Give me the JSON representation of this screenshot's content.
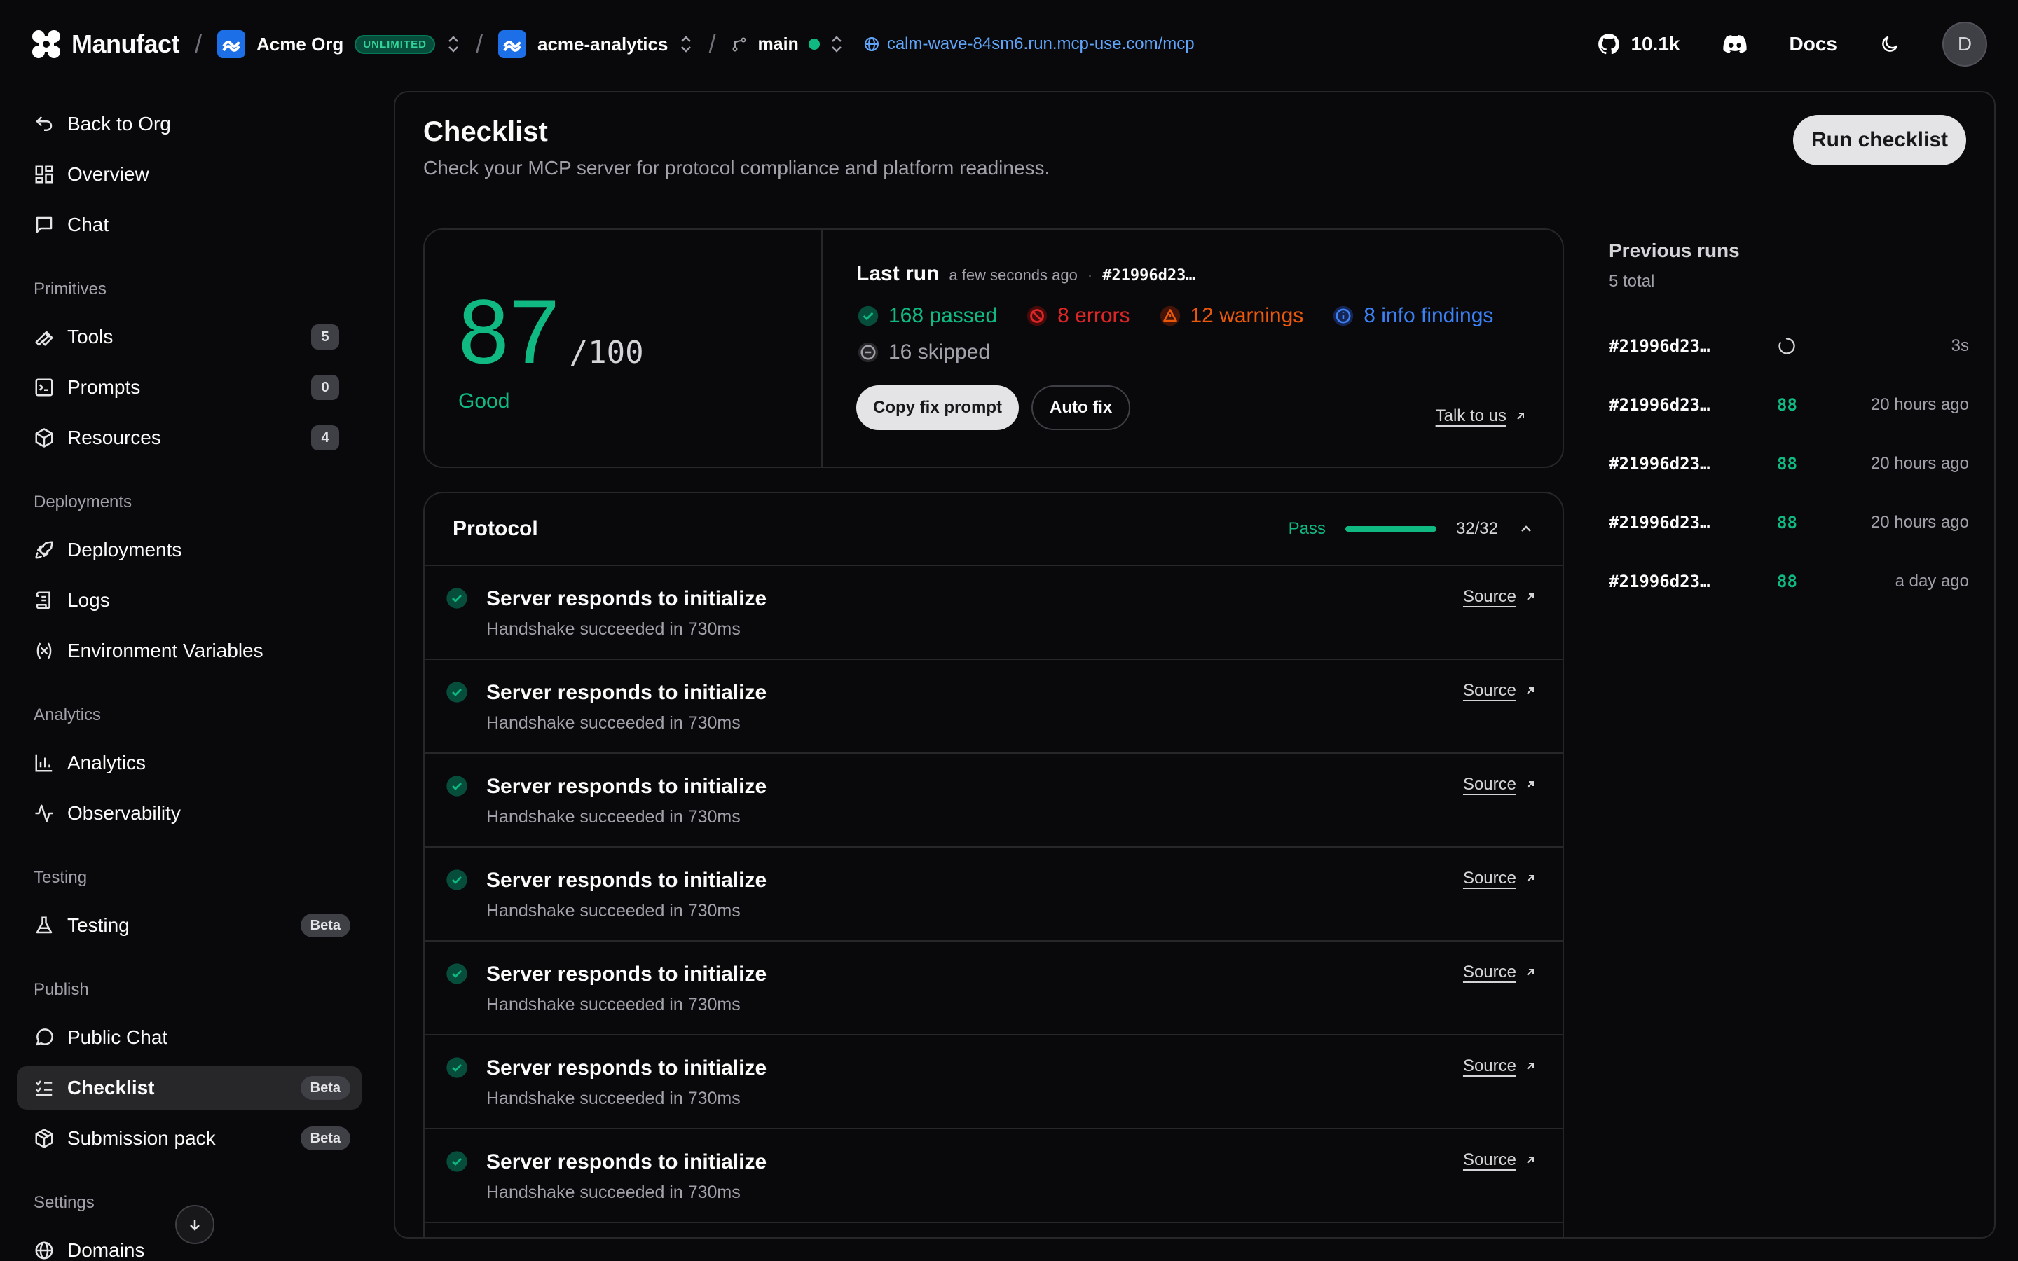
{
  "topbar": {
    "brand": "Manufact",
    "org_name": "Acme Org",
    "org_badge": "UNLIMITED",
    "project": "acme-analytics",
    "branch": "main",
    "url": "calm-wave-84sm6.run.mcp-use.com/mcp",
    "github_stars": "10.1k",
    "docs": "Docs",
    "avatar_initial": "D"
  },
  "sidebar": {
    "back": "Back to Org",
    "overview": "Overview",
    "chat": "Chat",
    "primitives_label": "Primitives",
    "tools": "Tools",
    "tools_count": "5",
    "prompts": "Prompts",
    "prompts_count": "0",
    "resources": "Resources",
    "resources_count": "4",
    "deployments_label": "Deployments",
    "deployments": "Deployments",
    "logs": "Logs",
    "env_vars": "Environment Variables",
    "analytics_label": "Analytics",
    "analytics": "Analytics",
    "observability": "Observability",
    "testing_label": "Testing",
    "testing": "Testing",
    "testing_badge": "Beta",
    "publish_label": "Publish",
    "public_chat": "Public Chat",
    "checklist": "Checklist",
    "checklist_badge": "Beta",
    "submission_pack": "Submission pack",
    "submission_badge": "Beta",
    "settings_label": "Settings",
    "domains": "Domains"
  },
  "main": {
    "title": "Checklist",
    "subtitle": "Check your MCP server for protocol compliance and platform readiness.",
    "run_button": "Run checklist"
  },
  "score": {
    "value": "87",
    "max": "/100",
    "label": "Good",
    "last_run_label": "Last run",
    "last_run_when": "a few seconds ago",
    "last_run_dot": "·",
    "last_run_hash": "#21996d23…",
    "passed": "168 passed",
    "errors": "8 errors",
    "warnings": "12 warnings",
    "info": "8 info findings",
    "skipped": "16 skipped",
    "copy_fix": "Copy fix prompt",
    "auto_fix": "Auto fix",
    "talk": "Talk to us"
  },
  "protocol": {
    "title": "Protocol",
    "status": "Pass",
    "progress": 1.0,
    "count": "32/32",
    "rows": [
      {
        "title": "Server responds to initialize",
        "sub": "Handshake succeeded in 730ms",
        "source": "Source"
      },
      {
        "title": "Server responds to initialize",
        "sub": "Handshake succeeded in 730ms",
        "source": "Source"
      },
      {
        "title": "Server responds to initialize",
        "sub": "Handshake succeeded in 730ms",
        "source": "Source"
      },
      {
        "title": "Server responds to initialize",
        "sub": "Handshake succeeded in 730ms",
        "source": "Source"
      },
      {
        "title": "Server responds to initialize",
        "sub": "Handshake succeeded in 730ms",
        "source": "Source"
      },
      {
        "title": "Server responds to initialize",
        "sub": "Handshake succeeded in 730ms",
        "source": "Source"
      },
      {
        "title": "Server responds to initialize",
        "sub": "Handshake succeeded in 730ms",
        "source": "Source"
      }
    ]
  },
  "previous_runs": {
    "title": "Previous runs",
    "total": "5 total",
    "runs": [
      {
        "hash": "#21996d23…",
        "score": "",
        "time": "3s",
        "running": true
      },
      {
        "hash": "#21996d23…",
        "score": "88",
        "time": "20 hours ago"
      },
      {
        "hash": "#21996d23…",
        "score": "88",
        "time": "20 hours ago"
      },
      {
        "hash": "#21996d23…",
        "score": "88",
        "time": "20 hours ago"
      },
      {
        "hash": "#21996d23…",
        "score": "88",
        "time": "a day ago"
      }
    ]
  },
  "colors": {
    "success": "#10b981",
    "error": "#dc2626",
    "warning": "#ea580c",
    "info": "#3b82f6",
    "link": "#60a5fa"
  }
}
